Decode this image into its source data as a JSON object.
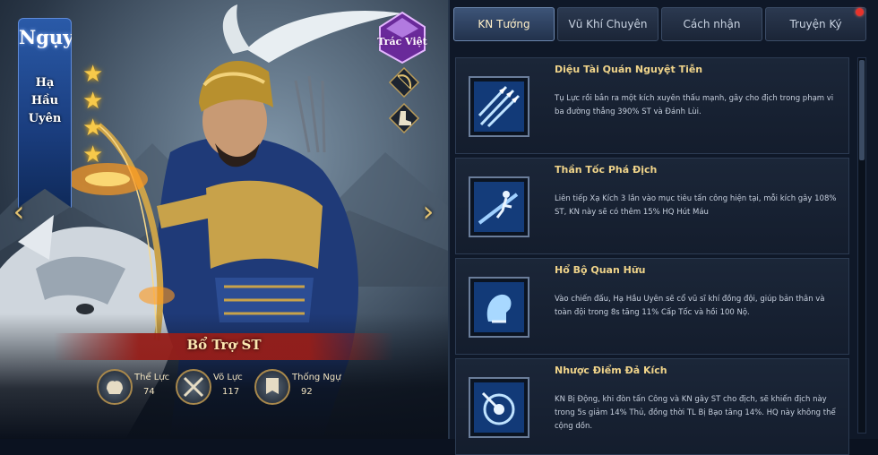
{
  "hero": {
    "faction": "Ngụy",
    "name_lines": [
      "Hạ",
      "Hầu",
      "Uyên"
    ],
    "stars": 4,
    "role": "Bổ Trợ ST",
    "seal_text": "Trác Việt",
    "stats": [
      {
        "label": "Thể Lực",
        "value": "74",
        "icon": "strength-icon"
      },
      {
        "label": "Võ Lực",
        "value": "117",
        "icon": "crossed-swords-icon"
      },
      {
        "label": "Thống Ngự",
        "value": "92",
        "icon": "banner-icon"
      }
    ],
    "side_icons": [
      "bow-icon",
      "boot-icon"
    ]
  },
  "tabs": [
    {
      "label": "KN Tướng",
      "active": true
    },
    {
      "label": "Vũ Khí Chuyên",
      "active": false
    },
    {
      "label": "Cách nhận",
      "active": false
    },
    {
      "label": "Truyện Ký",
      "active": false
    }
  ],
  "skills": [
    {
      "name": "Diệu Tài Quán Nguyệt Tiễn",
      "desc": "Tụ Lực rồi bắn ra một kích xuyên thấu mạnh, gây cho địch trong phạm vi ba đường thẳng 390% ST và Đánh Lùi.",
      "icon": "arrows-icon"
    },
    {
      "name": "Thần Tốc Phá Địch",
      "desc": "Liên tiếp Xạ Kích 3 lần vào mục tiêu tấn công hiện tại, mỗi kích gây 108% ST, KN này sẽ có thêm 15% HQ Hút Máu",
      "icon": "archer-icon"
    },
    {
      "name": "Hổ Bộ Quan Hữu",
      "desc": "Vào chiến đấu, Hạ Hầu Uyên sẽ cổ vũ sĩ khí đồng đội, giúp bản thân và toàn đội trong 8s tăng 11% Cấp Tốc và hồi 100 Nộ.",
      "icon": "fist-icon"
    },
    {
      "name": "Nhược Điểm Đả Kích",
      "desc": "KN Bị Động, khi đòn tấn Công và KN gây ST cho địch, sẽ khiến địch này trong 5s giảm 14% Thủ, đồng thời TL Bị Bạo tăng 14%. HQ này không thể cộng dồn.",
      "icon": "target-icon"
    }
  ]
}
